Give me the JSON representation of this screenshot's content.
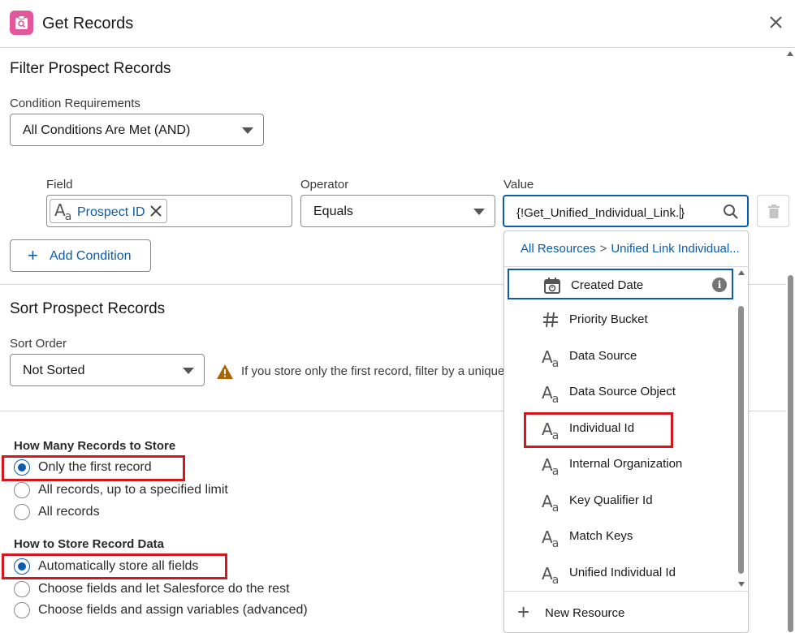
{
  "header": {
    "title": "Get Records"
  },
  "filter": {
    "title": "Filter Prospect Records",
    "condition_label": "Condition Requirements",
    "condition_value": "All Conditions Are Met (AND)",
    "field_label": "Field",
    "operator_label": "Operator",
    "value_label": "Value",
    "field_pill": "Prospect ID",
    "operator_value": "Equals",
    "value_text": "{!Get_Unified_Individual_Link.",
    "value_close": "}",
    "add_condition": "Add Condition"
  },
  "sort": {
    "title": "Sort Prospect Records",
    "order_label": "Sort Order",
    "order_value": "Not Sorted",
    "warning": "If you store only the first record, filter by a unique"
  },
  "how_many": {
    "title": "How Many Records to Store",
    "options": [
      "Only the first record",
      "All records, up to a specified limit",
      "All records"
    ],
    "selected": 0
  },
  "how_store": {
    "title": "How to Store Record Data",
    "options": [
      "Automatically store all fields",
      "Choose fields and let Salesforce do the rest",
      "Choose fields and assign variables (advanced)"
    ],
    "selected": 0
  },
  "dropdown": {
    "breadcrumb_root": "All Resources",
    "breadcrumb_sep": ">",
    "breadcrumb_current": "Unified Link Individual...",
    "items": [
      {
        "label": "Created Date",
        "icon": "calendar-icon"
      },
      {
        "label": "Priority Bucket",
        "icon": "number-icon"
      },
      {
        "label": "Data Source",
        "icon": "text-icon"
      },
      {
        "label": "Data Source Object",
        "icon": "text-icon"
      },
      {
        "label": "Individual Id",
        "icon": "text-icon"
      },
      {
        "label": "Internal Organization",
        "icon": "text-icon"
      },
      {
        "label": "Key Qualifier Id",
        "icon": "text-icon"
      },
      {
        "label": "Match Keys",
        "icon": "text-icon"
      },
      {
        "label": "Unified Individual Id",
        "icon": "text-icon"
      }
    ],
    "new_resource": "New Resource"
  },
  "colors": {
    "brand_blue": "#0b5cab",
    "highlight_red": "#d4161e",
    "app_icon_pink": "#e3589c"
  }
}
